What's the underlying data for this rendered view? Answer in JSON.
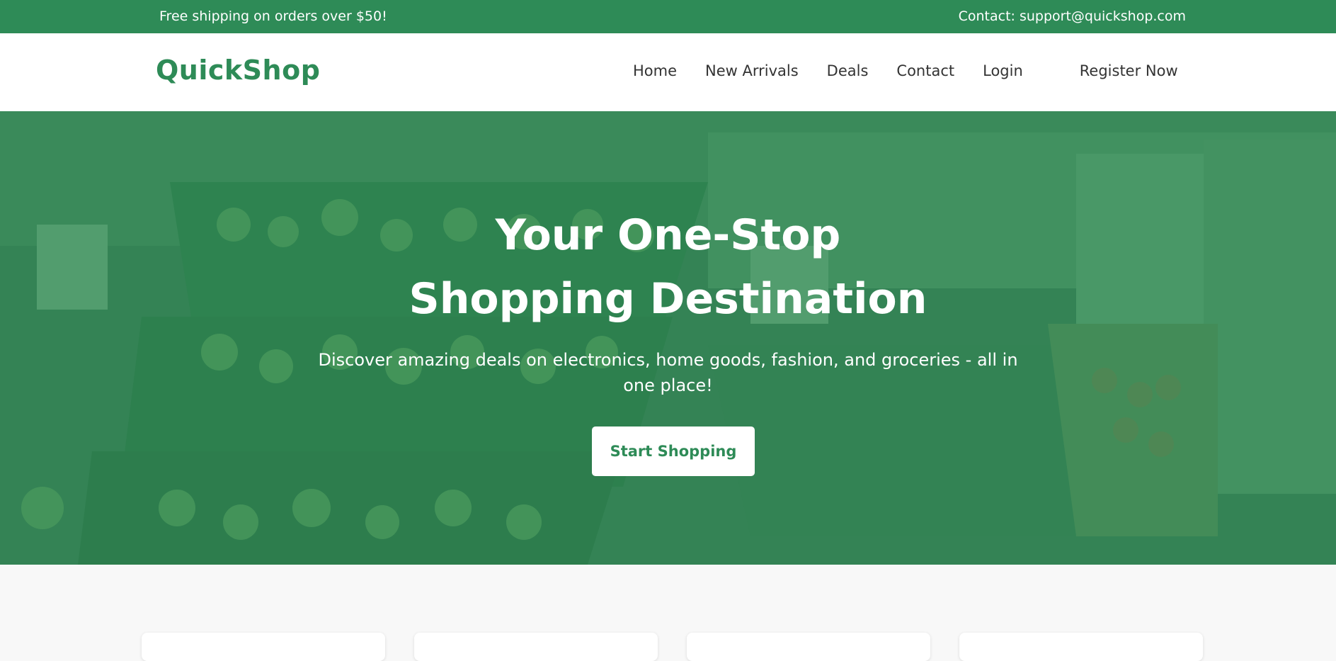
{
  "topbar": {
    "promo": "Free shipping on orders over $50!",
    "contact": "Contact: support@quickshop.com"
  },
  "header": {
    "logo": "QuickShop",
    "nav": [
      "Home",
      "New Arrivals",
      "Deals",
      "Contact",
      "Login"
    ],
    "register": "Register Now"
  },
  "hero": {
    "title": "Your One-Stop Shopping Destination",
    "subtitle": "Discover amazing deals on electronics, home goods, fashion, and groceries - all in one place!",
    "button": "Start Shopping",
    "background_image": "supermarket-produce-display-photo"
  },
  "colors": {
    "brand": "#2e8b57",
    "white": "#ffffff",
    "text": "#333333",
    "section_bg": "#f8f8f8"
  }
}
